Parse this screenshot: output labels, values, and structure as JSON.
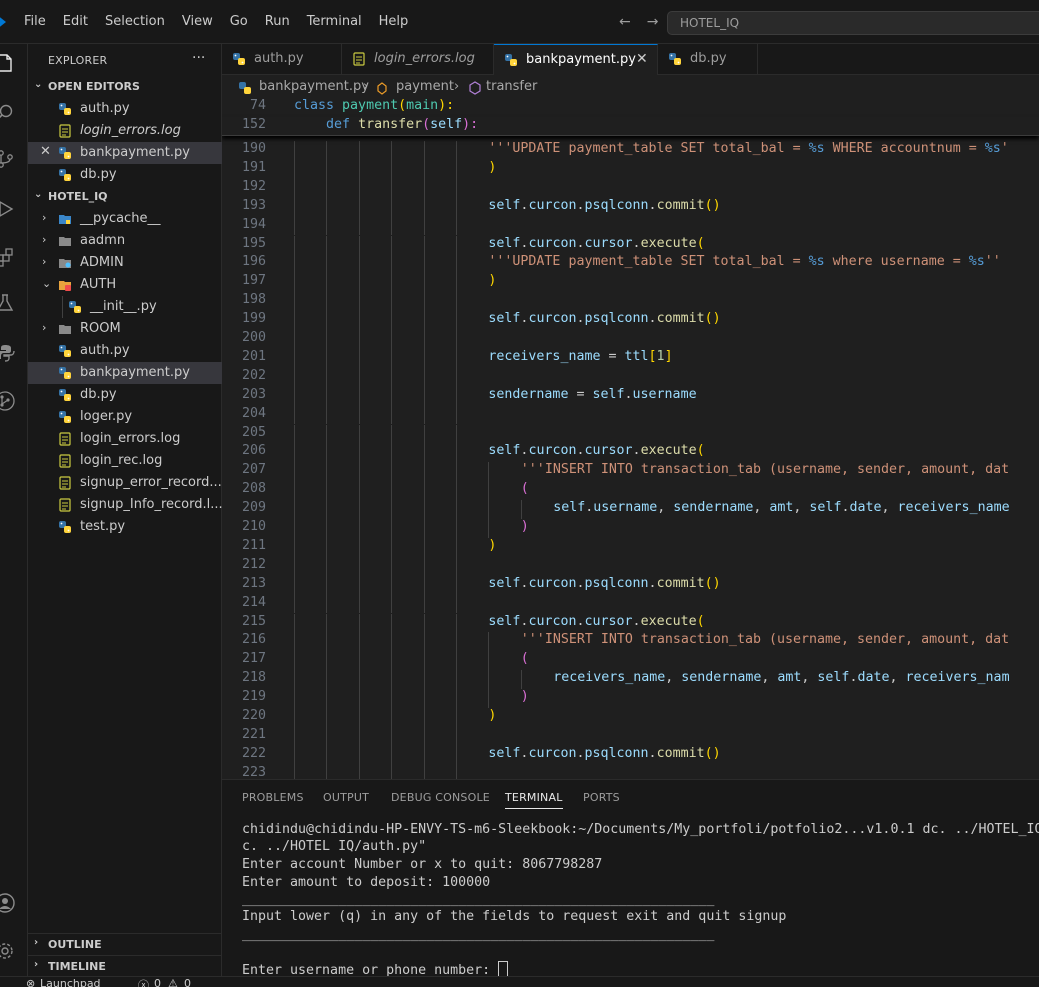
{
  "titlebar": {
    "menus": [
      "File",
      "Edit",
      "Selection",
      "View",
      "Go",
      "Run",
      "Terminal",
      "Help"
    ],
    "back_glyph": "←",
    "forward_glyph": "→",
    "search_text": "HOTEL_IQ"
  },
  "activity_bar": [
    "files-icon",
    "search-icon",
    "source-control-icon",
    "run-debug-icon",
    "extensions-icon",
    "testing-icon",
    "python-icon",
    "git-graph-icon",
    "account-icon",
    "settings-gear-icon"
  ],
  "sidebar": {
    "title": "EXPLORER",
    "more": "···",
    "open_editors": {
      "label": "OPEN EDITORS",
      "items": [
        {
          "name": "auth.py",
          "icon": "python"
        },
        {
          "name": "login_errors.log",
          "icon": "log",
          "italic": true
        },
        {
          "name": "bankpayment.py",
          "icon": "python",
          "close": "✕",
          "selected": true
        },
        {
          "name": "db.py",
          "icon": "python"
        }
      ]
    },
    "workspace": {
      "label": "HOTEL_IQ",
      "items": [
        {
          "name": "__pycache__",
          "icon": "folder-blue",
          "chev": "›"
        },
        {
          "name": "aadmn",
          "icon": "folder",
          "chev": "›"
        },
        {
          "name": "ADMIN",
          "icon": "folder-admin",
          "chev": "›"
        },
        {
          "name": "AUTH",
          "icon": "folder-open",
          "chev": "⌄"
        },
        {
          "name": "__init__.py",
          "icon": "python",
          "indent": true
        },
        {
          "name": "ROOM",
          "icon": "folder",
          "chev": "›"
        },
        {
          "name": "auth.py",
          "icon": "python"
        },
        {
          "name": "bankpayment.py",
          "icon": "python",
          "selected": true
        },
        {
          "name": "db.py",
          "icon": "python"
        },
        {
          "name": "loger.py",
          "icon": "python"
        },
        {
          "name": "login_errors.log",
          "icon": "log"
        },
        {
          "name": "login_rec.log",
          "icon": "log"
        },
        {
          "name": "signup_error_record....",
          "icon": "log"
        },
        {
          "name": "signup_Info_record.l...",
          "icon": "log"
        },
        {
          "name": "test.py",
          "icon": "python"
        }
      ]
    },
    "outline": "OUTLINE",
    "timeline": "TIMELINE"
  },
  "tabs": [
    {
      "name": "auth.py",
      "icon": "python"
    },
    {
      "name": "login_errors.log",
      "icon": "log",
      "italic": true
    },
    {
      "name": "bankpayment.py",
      "icon": "python",
      "active": true,
      "close": "✕"
    },
    {
      "name": "db.py",
      "icon": "python"
    }
  ],
  "breadcrumbs": {
    "file": "bankpayment.py",
    "sep": "›",
    "cls": "payment",
    "method": "transfer"
  },
  "sticky": [
    {
      "line": "74",
      "tokens": [
        [
          "kw",
          "class "
        ],
        [
          "cls",
          "payment"
        ],
        [
          "br1",
          "("
        ],
        [
          "cls",
          "main"
        ],
        [
          "br1",
          "):"
        ]
      ]
    },
    {
      "line": "152",
      "tokens": [
        [
          "pn",
          "    "
        ],
        [
          "kw",
          "def "
        ],
        [
          "fn",
          "transfer"
        ],
        [
          "br2",
          "("
        ],
        [
          "var",
          "self"
        ],
        [
          "br2",
          "):"
        ]
      ]
    }
  ],
  "code": [
    {
      "line": "190",
      "indent": 6,
      "tokens": [
        [
          "str",
          "'''UPDATE payment_table SET total_bal = "
        ],
        [
          "kw",
          "%s"
        ],
        [
          "str",
          " WHERE accountnum = "
        ],
        [
          "kw",
          "%s"
        ],
        [
          "str",
          "'"
        ]
      ]
    },
    {
      "line": "191",
      "indent": 6,
      "tokens": [
        [
          "br1",
          ")"
        ]
      ]
    },
    {
      "line": "192",
      "indent": 6,
      "tokens": []
    },
    {
      "line": "193",
      "indent": 6,
      "tokens": [
        [
          "var",
          "self"
        ],
        [
          "pn",
          "."
        ],
        [
          "var",
          "curcon"
        ],
        [
          "pn",
          "."
        ],
        [
          "var",
          "psqlconn"
        ],
        [
          "pn",
          "."
        ],
        [
          "fn",
          "commit"
        ],
        [
          "br1",
          "()"
        ]
      ]
    },
    {
      "line": "194",
      "indent": 6,
      "tokens": []
    },
    {
      "line": "195",
      "indent": 6,
      "tokens": [
        [
          "var",
          "self"
        ],
        [
          "pn",
          "."
        ],
        [
          "var",
          "curcon"
        ],
        [
          "pn",
          "."
        ],
        [
          "var",
          "cursor"
        ],
        [
          "pn",
          "."
        ],
        [
          "fn",
          "execute"
        ],
        [
          "br1",
          "("
        ]
      ]
    },
    {
      "line": "196",
      "indent": 6,
      "tokens": [
        [
          "str",
          "'''UPDATE payment_table SET total_bal = "
        ],
        [
          "kw",
          "%s"
        ],
        [
          "str",
          " where username = "
        ],
        [
          "kw",
          "%s"
        ],
        [
          "str",
          "''"
        ]
      ]
    },
    {
      "line": "197",
      "indent": 6,
      "tokens": [
        [
          "br1",
          ")"
        ]
      ]
    },
    {
      "line": "198",
      "indent": 6,
      "tokens": []
    },
    {
      "line": "199",
      "indent": 6,
      "tokens": [
        [
          "var",
          "self"
        ],
        [
          "pn",
          "."
        ],
        [
          "var",
          "curcon"
        ],
        [
          "pn",
          "."
        ],
        [
          "var",
          "psqlconn"
        ],
        [
          "pn",
          "."
        ],
        [
          "fn",
          "commit"
        ],
        [
          "br1",
          "()"
        ]
      ]
    },
    {
      "line": "200",
      "indent": 6,
      "tokens": []
    },
    {
      "line": "201",
      "indent": 6,
      "tokens": [
        [
          "var",
          "receivers_name"
        ],
        [
          "pn",
          " = "
        ],
        [
          "var",
          "ttl"
        ],
        [
          "br1",
          "["
        ],
        [
          "num",
          "1"
        ],
        [
          "br1",
          "]"
        ]
      ]
    },
    {
      "line": "202",
      "indent": 6,
      "tokens": []
    },
    {
      "line": "203",
      "indent": 6,
      "tokens": [
        [
          "var",
          "sendername"
        ],
        [
          "pn",
          " = "
        ],
        [
          "var",
          "self"
        ],
        [
          "pn",
          "."
        ],
        [
          "var",
          "username"
        ]
      ]
    },
    {
      "line": "204",
      "indent": 6,
      "tokens": []
    },
    {
      "line": "205",
      "indent": 6,
      "tokens": []
    },
    {
      "line": "206",
      "indent": 6,
      "tokens": [
        [
          "var",
          "self"
        ],
        [
          "pn",
          "."
        ],
        [
          "var",
          "curcon"
        ],
        [
          "pn",
          "."
        ],
        [
          "var",
          "cursor"
        ],
        [
          "pn",
          "."
        ],
        [
          "fn",
          "execute"
        ],
        [
          "br1",
          "("
        ]
      ]
    },
    {
      "line": "207",
      "indent": 7,
      "tokens": [
        [
          "str",
          "'''INSERT INTO transaction_tab (username, sender, amount, dat"
        ]
      ]
    },
    {
      "line": "208",
      "indent": 7,
      "tokens": [
        [
          "br2",
          "("
        ]
      ]
    },
    {
      "line": "209",
      "indent": 8,
      "tokens": [
        [
          "var",
          "self"
        ],
        [
          "pn",
          "."
        ],
        [
          "var",
          "username"
        ],
        [
          "pn",
          ", "
        ],
        [
          "var",
          "sendername"
        ],
        [
          "pn",
          ", "
        ],
        [
          "var",
          "amt"
        ],
        [
          "pn",
          ", "
        ],
        [
          "var",
          "self"
        ],
        [
          "pn",
          "."
        ],
        [
          "var",
          "date"
        ],
        [
          "pn",
          ", "
        ],
        [
          "var",
          "receivers_name"
        ]
      ]
    },
    {
      "line": "210",
      "indent": 7,
      "tokens": [
        [
          "br2",
          ")"
        ]
      ]
    },
    {
      "line": "211",
      "indent": 6,
      "tokens": [
        [
          "br1",
          ")"
        ]
      ]
    },
    {
      "line": "212",
      "indent": 6,
      "tokens": []
    },
    {
      "line": "213",
      "indent": 6,
      "tokens": [
        [
          "var",
          "self"
        ],
        [
          "pn",
          "."
        ],
        [
          "var",
          "curcon"
        ],
        [
          "pn",
          "."
        ],
        [
          "var",
          "psqlconn"
        ],
        [
          "pn",
          "."
        ],
        [
          "fn",
          "commit"
        ],
        [
          "br1",
          "()"
        ]
      ]
    },
    {
      "line": "214",
      "indent": 6,
      "tokens": []
    },
    {
      "line": "215",
      "indent": 6,
      "tokens": [
        [
          "var",
          "self"
        ],
        [
          "pn",
          "."
        ],
        [
          "var",
          "curcon"
        ],
        [
          "pn",
          "."
        ],
        [
          "var",
          "cursor"
        ],
        [
          "pn",
          "."
        ],
        [
          "fn",
          "execute"
        ],
        [
          "br1",
          "("
        ]
      ]
    },
    {
      "line": "216",
      "indent": 7,
      "tokens": [
        [
          "str",
          "'''INSERT INTO transaction_tab (username, sender, amount, dat"
        ]
      ]
    },
    {
      "line": "217",
      "indent": 7,
      "tokens": [
        [
          "br2",
          "("
        ]
      ]
    },
    {
      "line": "218",
      "indent": 8,
      "tokens": [
        [
          "var",
          "receivers_name"
        ],
        [
          "pn",
          ", "
        ],
        [
          "var",
          "sendername"
        ],
        [
          "pn",
          ", "
        ],
        [
          "var",
          "amt"
        ],
        [
          "pn",
          ", "
        ],
        [
          "var",
          "self"
        ],
        [
          "pn",
          "."
        ],
        [
          "var",
          "date"
        ],
        [
          "pn",
          ", "
        ],
        [
          "var",
          "receivers_nam"
        ]
      ]
    },
    {
      "line": "219",
      "indent": 7,
      "tokens": [
        [
          "br2",
          ")"
        ]
      ]
    },
    {
      "line": "220",
      "indent": 6,
      "tokens": [
        [
          "br1",
          ")"
        ]
      ]
    },
    {
      "line": "221",
      "indent": 6,
      "tokens": []
    },
    {
      "line": "222",
      "indent": 6,
      "tokens": [
        [
          "var",
          "self"
        ],
        [
          "pn",
          "."
        ],
        [
          "var",
          "curcon"
        ],
        [
          "pn",
          "."
        ],
        [
          "var",
          "psqlconn"
        ],
        [
          "pn",
          "."
        ],
        [
          "fn",
          "commit"
        ],
        [
          "br1",
          "()"
        ]
      ]
    },
    {
      "line": "223",
      "indent": 6,
      "tokens": []
    }
  ],
  "panel": {
    "tabs": [
      "PROBLEMS",
      "OUTPUT",
      "DEBUG CONSOLE",
      "TERMINAL",
      "PORTS"
    ],
    "active_tab": "TERMINAL",
    "terminal_lines": [
      "chidindu@chidindu-HP-ENVY-TS-m6-Sleekbook:~/Documents/My_portfoli/potfolio2...v1.0.1 dc. ../HOTEL_IQ",
      "c. ../HOTEL IQ/auth.py\"",
      "Enter account Number or x to quit: 8067798287",
      "Enter amount to deposit: 100000",
      "___________________________________________________________",
      "Input lower (q) in any of the fields to request exit and quit signup",
      "___________________________________________________________",
      "",
      "Enter username or phone number: "
    ]
  },
  "statusbar": {
    "launchpad": "Launchpad",
    "errors": "0",
    "warnings": "0"
  }
}
